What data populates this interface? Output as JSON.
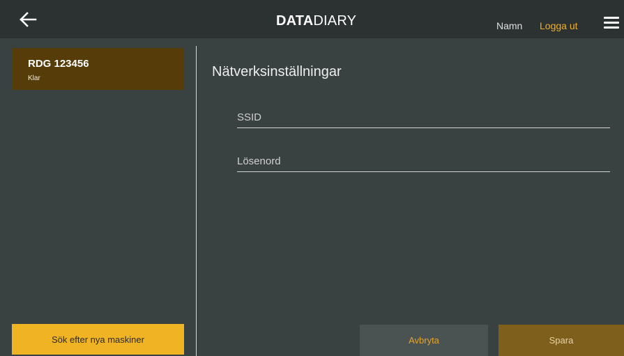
{
  "header": {
    "logo_bold": "DATA",
    "logo_light": "DIARY",
    "user_name": "Namn",
    "logout_label": "Logga ut",
    "back_icon": "arrow-left-icon",
    "menu_icon": "hamburger-menu-icon"
  },
  "sidebar": {
    "machines": [
      {
        "id": "RDG 123456",
        "status": "Klar"
      }
    ],
    "search_button_label": "Sök efter nya maskiner"
  },
  "main": {
    "title": "Nätverksinställningar",
    "fields": {
      "ssid_placeholder": "SSID",
      "password_placeholder": "Lösenord"
    },
    "cancel_label": "Avbryta",
    "save_label": "Spara"
  },
  "colors": {
    "accent": "#f0b323",
    "background": "#3a4141",
    "header": "#2c3131",
    "selected_card": "#563c08",
    "save_button": "#7e5f1c"
  }
}
